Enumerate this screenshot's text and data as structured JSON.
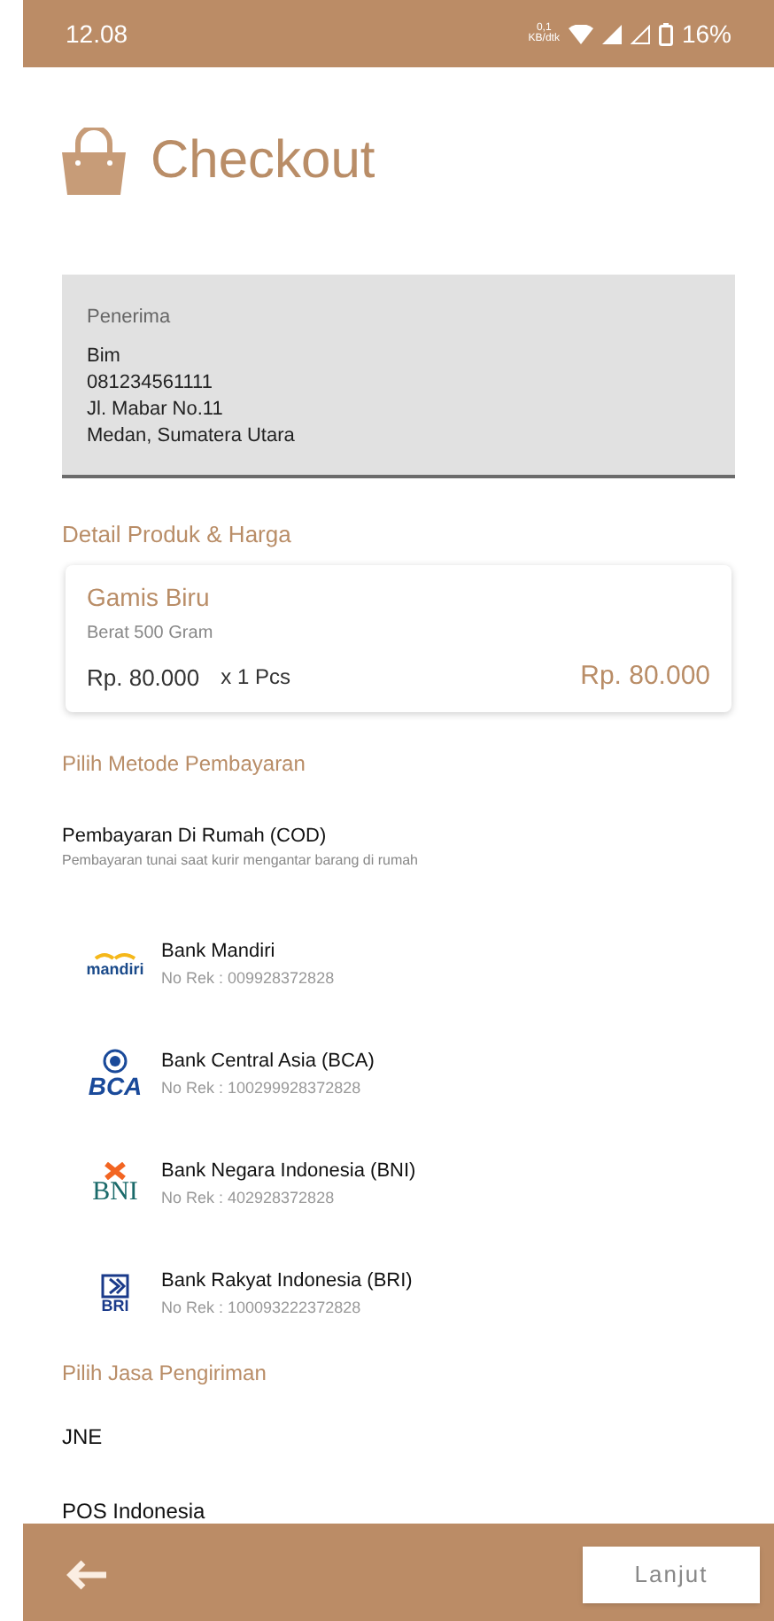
{
  "status_bar": {
    "time": "12.08",
    "speed": "0,1",
    "speed_unit": "KB/dtk",
    "battery": "16%"
  },
  "header": {
    "title": "Checkout"
  },
  "recipient": {
    "label": "Penerima",
    "lines": [
      "Bim",
      "081234561111",
      "Jl. Mabar No.11",
      "Medan, Sumatera Utara"
    ]
  },
  "product_section": {
    "title": "Detail Produk & Harga",
    "product": {
      "name": "Gamis Biru",
      "weight": "Berat 500 Gram",
      "price": "Rp. 80.000",
      "quantity": "x 1 Pcs",
      "total": "Rp. 80.000"
    }
  },
  "payment_section": {
    "title": "Pilih Metode Pembayaran",
    "methods": [
      {
        "kind": "cod",
        "name": "Pembayaran Di Rumah (COD)",
        "detail": "Pembayaran tunai saat kurir mengantar barang di rumah"
      },
      {
        "kind": "mandiri",
        "logo": "mandiri",
        "name": "Bank Mandiri",
        "detail": "No Rek : 009928372828"
      },
      {
        "kind": "bca",
        "logo": "BCA",
        "name": "Bank Central Asia (BCA)",
        "detail": "No Rek : 100299928372828"
      },
      {
        "kind": "bni",
        "logo": "BNI",
        "name": "Bank Negara Indonesia (BNI)",
        "detail": "No Rek : 402928372828"
      },
      {
        "kind": "bri",
        "logo": "BRI",
        "name": "Bank Rakyat Indonesia (BRI)",
        "detail": "No Rek : 100093222372828"
      }
    ]
  },
  "shipping_section": {
    "title": "Pilih Jasa Pengiriman",
    "options": [
      "JNE",
      "POS Indonesia"
    ]
  },
  "bottom_bar": {
    "next_button": "Lanjut"
  }
}
